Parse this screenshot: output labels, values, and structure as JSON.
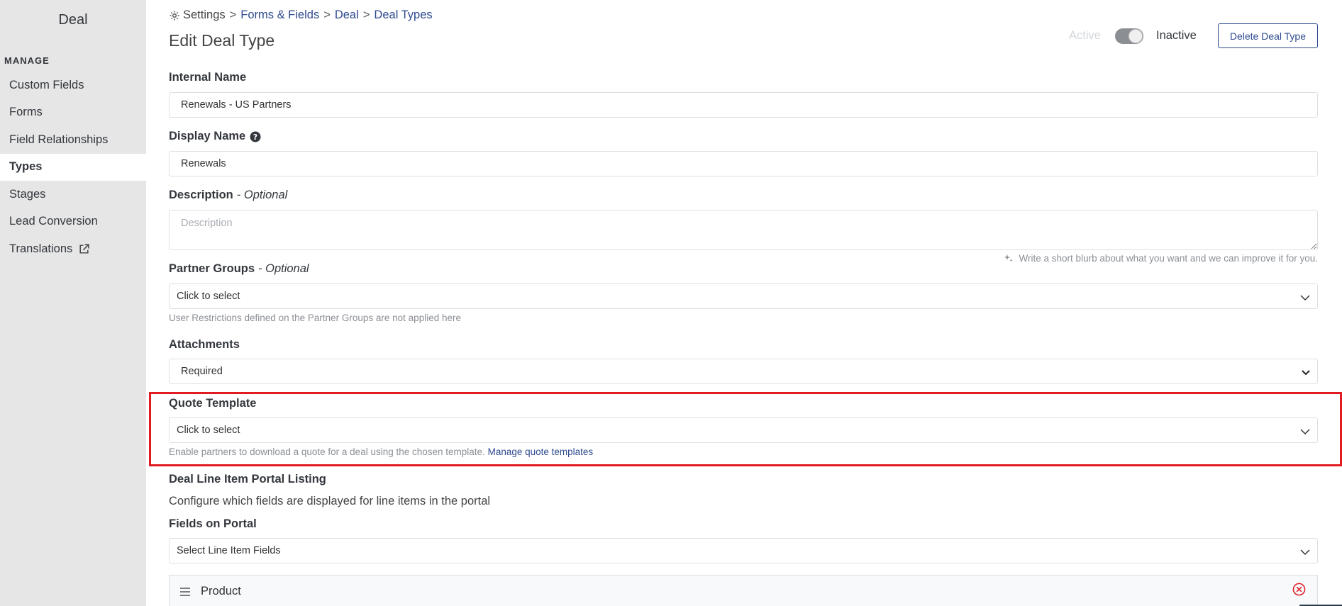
{
  "sidebar": {
    "title": "Deal",
    "section": "MANAGE",
    "items": [
      {
        "label": "Custom Fields"
      },
      {
        "label": "Forms"
      },
      {
        "label": "Field Relationships"
      },
      {
        "label": "Types"
      },
      {
        "label": "Stages"
      },
      {
        "label": "Lead Conversion"
      },
      {
        "label": "Translations"
      }
    ]
  },
  "breadcrumb": {
    "root": "Settings",
    "sep": ">",
    "items": [
      "Forms & Fields",
      "Deal",
      "Deal Types"
    ]
  },
  "page": {
    "title": "Edit Deal Type",
    "status_active": "Active",
    "status_inactive": "Inactive",
    "delete_label": "Delete Deal Type"
  },
  "form": {
    "internal_name": {
      "label": "Internal Name",
      "value": "Renewals - US Partners"
    },
    "display_name": {
      "label": "Display Name",
      "value": "Renewals"
    },
    "description": {
      "label": "Description",
      "optional": "- Optional",
      "placeholder": "Description",
      "hint": "Write a short blurb about what you want and we can improve it for you."
    },
    "partner_groups": {
      "label": "Partner Groups",
      "optional": "- Optional",
      "value": "Click to select",
      "helper": "User Restrictions defined on the Partner Groups are not applied here"
    },
    "attachments": {
      "label": "Attachments",
      "value": "Required"
    },
    "quote_template": {
      "label": "Quote Template",
      "value": "Click to select",
      "helper": "Enable partners to download a quote for a deal using the chosen template.",
      "link": "Manage quote templates"
    },
    "line_items": {
      "title": "Deal Line Item Portal Listing",
      "desc": "Configure which fields are displayed for line items in the portal",
      "fields_label": "Fields on Portal",
      "select_value": "Select Line Item Fields",
      "items": [
        {
          "label": "Product"
        }
      ]
    }
  },
  "colors": {
    "accent": "#2e4b8f",
    "highlight": "#e11b22",
    "sidebar_bg": "#e6e6e6",
    "remove": "#e11b22"
  }
}
